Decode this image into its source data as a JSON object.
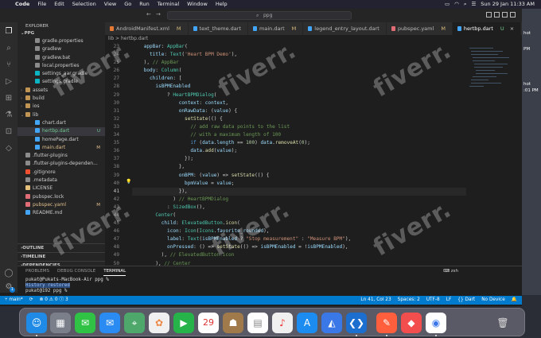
{
  "menubar": {
    "app": "Code",
    "items": [
      "File",
      "Edit",
      "Selection",
      "View",
      "Go",
      "Run",
      "Terminal",
      "Window",
      "Help"
    ],
    "datetime": "Sun 29 Jan  11:33 AM"
  },
  "desktop": {
    "labels": [
      "hot",
      "PM",
      "hot",
      ":01 PM"
    ]
  },
  "titlebar": {
    "search": "ppg"
  },
  "activity": {
    "badge": "1"
  },
  "sidebar": {
    "header": "EXPLORER",
    "root": "PPG",
    "items": [
      {
        "label": "gradle.properties",
        "color": "#8b8b8b",
        "status": ""
      },
      {
        "label": "gradlew",
        "color": "#8b8b8b",
        "status": ""
      },
      {
        "label": "gradlew.bat",
        "color": "#8b8b8b",
        "status": ""
      },
      {
        "label": "local.properties",
        "color": "#8b8b8b",
        "status": ""
      },
      {
        "label": "settings_aar.gradle",
        "color": "#0bb5c2",
        "status": ""
      },
      {
        "label": "settings.gradle",
        "color": "#0bb5c2",
        "status": ""
      },
      {
        "label": "assets",
        "color": "#c09553",
        "status": ""
      },
      {
        "label": "build",
        "color": "#c09553",
        "status": ""
      },
      {
        "label": "ios",
        "color": "#c09553",
        "status": ""
      },
      {
        "label": "lib",
        "color": "#c09553",
        "status": ""
      },
      {
        "label": "chart.dart",
        "color": "#42a5f5",
        "status": ""
      },
      {
        "label": "hertbp.dart",
        "color": "#42a5f5",
        "status": "U"
      },
      {
        "label": "homePage.dart",
        "color": "#42a5f5",
        "status": ""
      },
      {
        "label": "main.dart",
        "color": "#42a5f5",
        "status": "M"
      },
      {
        "label": ".flutter-plugins",
        "color": "#8b8b8b",
        "status": ""
      },
      {
        "label": ".flutter-plugins-dependen...",
        "color": "#8b8b8b",
        "status": ""
      },
      {
        "label": ".gitignore",
        "color": "#f1502f",
        "status": ""
      },
      {
        "label": ".metadata",
        "color": "#8b8b8b",
        "status": ""
      },
      {
        "label": "LICENSE",
        "color": "#e5c07b",
        "status": ""
      },
      {
        "label": "pubspec.lock",
        "color": "#e06c75",
        "status": ""
      },
      {
        "label": "pubspec.yaml",
        "color": "#e06c75",
        "status": "M"
      },
      {
        "label": "README.md",
        "color": "#42a5f5",
        "status": ""
      }
    ],
    "sections": [
      "OUTLINE",
      "TIMELINE",
      "DEPENDENCIES"
    ]
  },
  "tabs": [
    {
      "label": "AndroidManifest.xml",
      "mark": "M"
    },
    {
      "label": "text_theme.dart",
      "mark": ""
    },
    {
      "label": "main.dart",
      "mark": "M"
    },
    {
      "label": "legend_entry_layout.dart",
      "mark": ""
    },
    {
      "label": "pubspec.yaml",
      "mark": "M"
    },
    {
      "label": "hertbp.dart",
      "mark": "U"
    }
  ],
  "breadcrumb": "lib > hertbp.dart",
  "editor": {
    "line_numbers": [
      "23",
      "24",
      "25",
      "26",
      "27",
      "28",
      "29",
      "30",
      "31",
      "32",
      "33",
      "34",
      "35",
      "36",
      "37",
      "38",
      "39",
      "40",
      "41",
      "42",
      "43",
      "44",
      "45",
      "46",
      "47",
      "48",
      "49",
      "50",
      "51",
      "52",
      "53"
    ],
    "current_line": "41"
  },
  "panel": {
    "tabs": [
      "PROBLEMS",
      "DEBUG CONSOLE",
      "TERMINAL"
    ],
    "shell": "zsh",
    "terminal": [
      "pukat@Pukats-MacBook-Air ppg %",
      "History restored",
      "",
      "pukat@192 ppg %"
    ]
  },
  "statusbar": {
    "branch": "main*",
    "problems": "⊗ 0 ⚠ 0 ⓘ 3",
    "position": "Ln 41, Col 23",
    "spaces": "Spaces: 2",
    "encoding": "UTF-8",
    "eol": "LF",
    "language": "Dart",
    "device": "No Device"
  },
  "watermark": "fiverr."
}
